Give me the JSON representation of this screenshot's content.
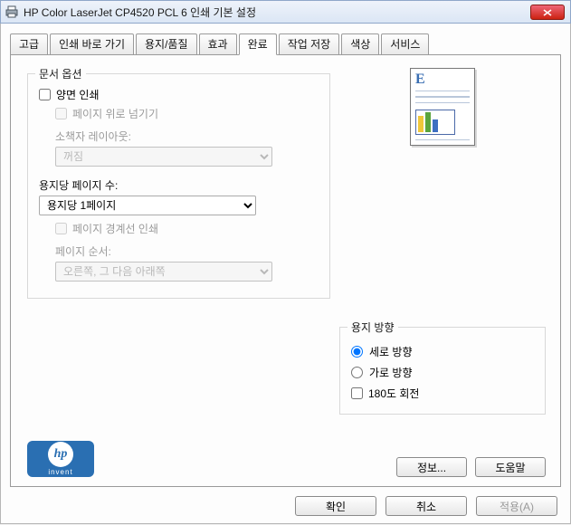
{
  "title": "HP Color LaserJet CP4520 PCL 6 인쇄 기본 설정",
  "tabs": {
    "t0": "고급",
    "t1": "인쇄 바로 가기",
    "t2": "용지/품질",
    "t3": "효과",
    "t4": "완료",
    "t5": "작업 저장",
    "t6": "색상",
    "t7": "서비스"
  },
  "doc_options": {
    "legend": "문서 옵션",
    "duplex": "양면 인쇄",
    "flip_up": "페이지 위로 넘기기",
    "booklet_label": "소책자 레이아웃:",
    "booklet_value": "꺼짐",
    "pps_label": "용지당 페이지 수:",
    "pps_value": "용지당 1페이지",
    "borders": "페이지 경계선 인쇄",
    "page_order_label": "페이지 순서:",
    "page_order_value": "오른쪽, 그 다음 아래쪽"
  },
  "orientation": {
    "legend": "용지 방향",
    "portrait": "세로 방향",
    "landscape": "가로 방향",
    "rotate180": "180도 회전"
  },
  "logo_sub": "invent",
  "buttons": {
    "info": "정보...",
    "help": "도움말",
    "ok": "확인",
    "cancel": "취소",
    "apply": "적용(A)"
  }
}
